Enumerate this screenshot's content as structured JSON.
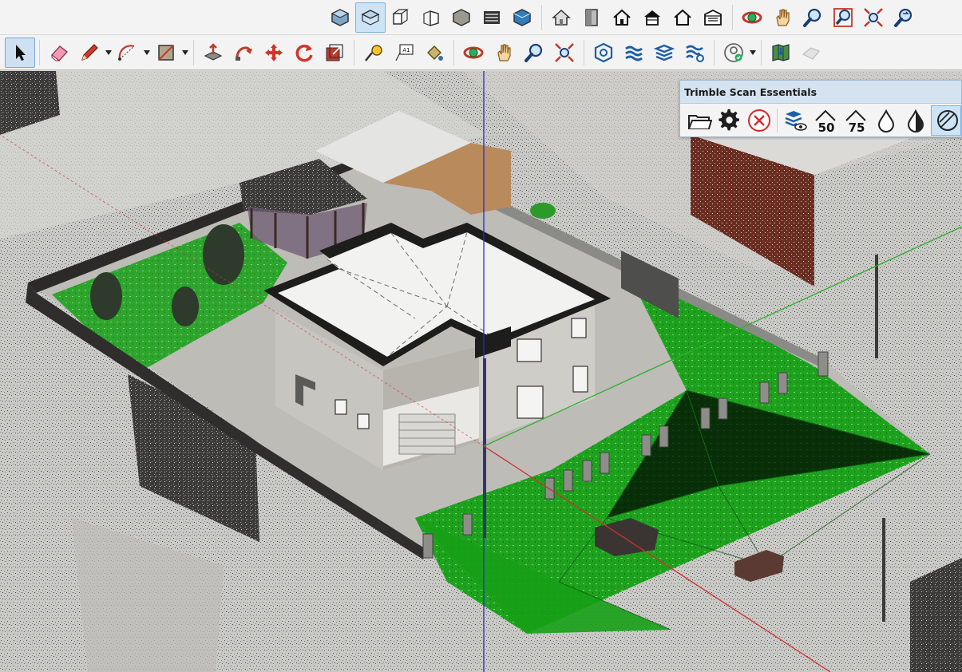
{
  "toolbar_top": {
    "groups": [
      [
        "iso-view-icon",
        "top-view-icon",
        "front-view-icon",
        "right-view-icon",
        "back-view-icon",
        "left-view-icon",
        "bottom-view-icon"
      ],
      [
        "home-icon",
        "door-icon",
        "house-outline-icon",
        "house-icon",
        "house-plain-icon",
        "garage-icon"
      ],
      [
        "orbit-icon",
        "pan-hand-icon",
        "zoom-icon",
        "zoom-window-icon",
        "zoom-extents-icon",
        "previous-view-icon"
      ]
    ]
  },
  "toolbar_main": {
    "groups": [
      [
        "select-arrow-icon"
      ],
      [
        "eraser-icon",
        "pencil-icon",
        "arc-icon",
        "rectangle-icon"
      ],
      [
        "push-pull-icon",
        "follow-me-icon",
        "move-icon",
        "rotate-icon",
        "scale-icon"
      ],
      [
        "tape-measure-icon",
        "text-label-icon",
        "paint-bucket-icon"
      ],
      [
        "orbit-icon",
        "pan-hand-icon",
        "zoom-icon",
        "zoom-extents-icon"
      ],
      [
        "scan-box-icon",
        "layers-wave-icon",
        "layers-stack-icon",
        "layers-gear-icon"
      ],
      [
        "user-check-icon"
      ],
      [
        "map-pin-icon",
        "eraser-cloud-icon"
      ]
    ]
  },
  "scan_panel": {
    "title": "Trimble Scan Essentials",
    "buttons": [
      {
        "icon": "open-folder-icon"
      },
      {
        "icon": "settings-gear-icon"
      },
      {
        "icon": "close-circle-icon"
      },
      {
        "icon": "view-layers-eye-icon"
      },
      {
        "icon": "density-50-icon",
        "label": "50"
      },
      {
        "icon": "density-75-icon",
        "label": "75"
      },
      {
        "icon": "drop-outline-icon"
      },
      {
        "icon": "drop-half-icon"
      },
      {
        "icon": "slice-icon"
      }
    ]
  },
  "colors": {
    "toolbar_bg": "#f3f3f3",
    "panel_title_bg": "#d5e3f1",
    "ground_green": "#18a018",
    "axis_blue": "#2a2acc",
    "axis_red": "#d03030",
    "axis_green": "#30b030"
  }
}
